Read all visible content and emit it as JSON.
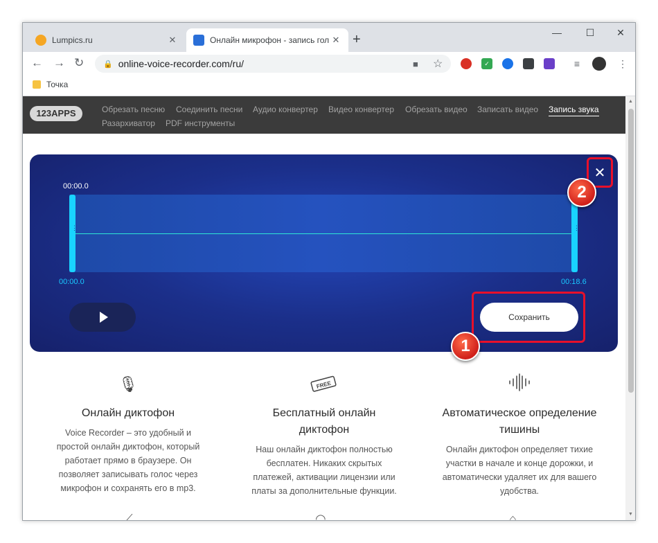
{
  "browser": {
    "tabs": [
      {
        "title": "Lumpics.ru",
        "favicon_color": "#f5a623"
      },
      {
        "title": "Онлайн микрофон - запись гол",
        "favicon_color": "#2a6fd8"
      }
    ],
    "new_tab": "+",
    "window_controls": {
      "minimize": "—",
      "maximize": "☐",
      "close": "✕"
    },
    "url": "online-voice-recorder.com/ru/",
    "bookmark": "Точка"
  },
  "site": {
    "logo": "123APPS",
    "nav": [
      "Обрезать песню",
      "Соединить песни",
      "Аудио конвертер",
      "Видео конвертер",
      "Обрезать видео",
      "Записать видео",
      "Запись звука",
      "Разархиватор",
      "PDF инструменты"
    ]
  },
  "recorder": {
    "time_top": "00:00.0",
    "time_start": "00:00.0",
    "time_end": "00:18.6",
    "save_label": "Сохранить",
    "close_icon": "✕"
  },
  "annotations": {
    "step1": "1",
    "step2": "2"
  },
  "features": [
    {
      "icon": "microphone-icon",
      "title_lines": [
        "Онлайн диктофон"
      ],
      "desc_lines": [
        "Voice Recorder – это удобный и",
        "простой онлайн диктофон, который",
        "работает прямо в браузере. Он",
        "позволяет записывать голос через",
        "микрофон и сохранять его в mp3."
      ]
    },
    {
      "icon": "free-tag-icon",
      "title_lines": [
        "Бесплатный онлайн",
        "диктофон"
      ],
      "desc_lines": [
        "Наш онлайн диктофон полностью",
        "бесплатен. Никаких скрытых",
        "платежей, активации лицензии или",
        "платы за дополнительные функции."
      ]
    },
    {
      "icon": "sound-wave-icon",
      "title_lines": [
        "Автоматическое определение",
        "тишины"
      ],
      "desc_lines": [
        "Онлайн диктофон определяет тихие",
        "участки в начале и конце дорожки, и",
        "автоматически удаляет их для вашего",
        "удобства."
      ]
    }
  ],
  "colors": {
    "accent": "#19d3ff",
    "panel": "#1b2f8a",
    "highlight": "#e8102a"
  }
}
